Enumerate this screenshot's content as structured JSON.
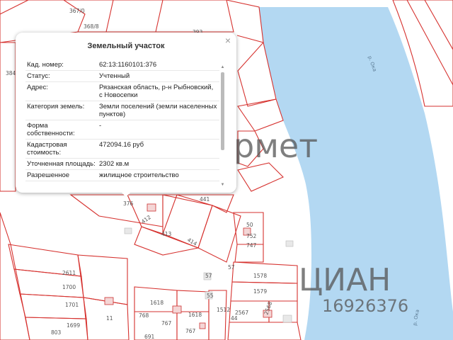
{
  "popup": {
    "title": "Земельный участок",
    "close_glyph": "×",
    "rows": [
      {
        "label": "Кад. номер:",
        "value": "62:13:1160101:376"
      },
      {
        "label": "Статус:",
        "value": "Учтенный"
      },
      {
        "label": "Адрес:",
        "value": "Рязанская область, р-н Рыбновский, с Новосепки"
      },
      {
        "label": "Категория земель:",
        "value": "Земли поселений (земли населенных пунктов)"
      },
      {
        "label": "Форма собственности:",
        "value": "-"
      },
      {
        "label": "Кадастровая стоимость:",
        "value": "472094.16 руб"
      },
      {
        "label": "Уточненная площадь:",
        "value": "2302 кв.м"
      },
      {
        "label": "Разрешенное",
        "value": "жилищное строительство"
      }
    ]
  },
  "map": {
    "river_name_1": "р. Ока",
    "river_name_2": "р. Ока",
    "parcel_labels": [
      "367/0",
      "368/8",
      "393",
      "384",
      "376",
      "412",
      "413",
      "414",
      "441",
      "50",
      "752",
      "747",
      "57",
      "55",
      "1578",
      "1579",
      "2611",
      "1700",
      "1701",
      "1699",
      "803",
      "1618",
      "1618",
      "768",
      "767",
      "767",
      "691",
      "57",
      "1512",
      "2567",
      "2568",
      "44",
      "11"
    ],
    "watermark_1": "ЦИАН",
    "watermark_2": "16926376",
    "watermark_3": "рмет",
    "colors": {
      "river": "#b3d8f2",
      "parcel_border": "#d6322f",
      "building": "#f4d6d6"
    }
  }
}
